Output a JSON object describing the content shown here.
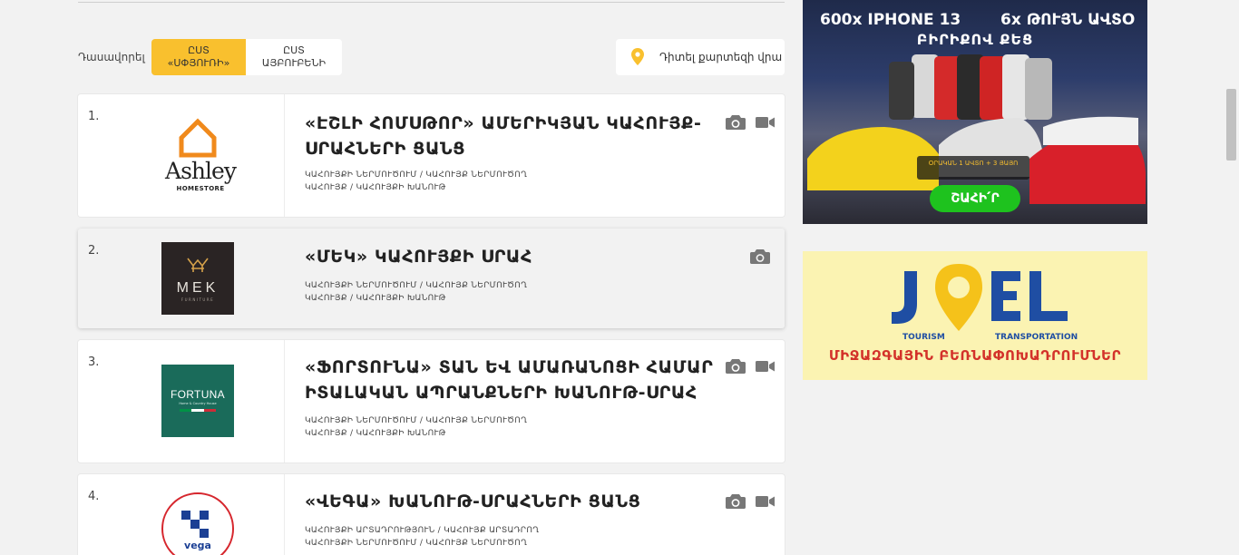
{
  "sort": {
    "label": "Դասավորել",
    "option_active_line1": "ԸՍՏ",
    "option_active_line2": "«ՍՓՅՈՒՌԻ»",
    "option_inactive_line1": "ԸՍՏ",
    "option_inactive_line2": "ԱՅԲՈՒԲԵՆԻ"
  },
  "map_button": {
    "label": "Դիտել քարտեզի վրա",
    "icon": "location-pin-icon",
    "color": "#f9c02e"
  },
  "listings": [
    {
      "number": "1.",
      "title_line1": "«ԷՇԼԻ ՀՈՄՍԹՈՐ» ԱՄԵՐԻԿՅԱՆ ԿԱՀՈՒՅՔ-",
      "title_line2": "ՍՐԱՀՆԵՐԻ ՑԱՆՑ",
      "cat_line1": "ԿԱՀՈՒՅՔԻ ՆԵՐՄՈՒԾՈՒՄ / ԿԱՀՈՒՅՔ ՆԵՐՄՈՒԾՈՂ",
      "cat_line2": "ԿԱՀՈՒՅՔ / ԿԱՀՈՒՅՔԻ ԽԱՆՈՒԹ",
      "logo_word": "Ashley",
      "logo_sub": "HOMESTORE",
      "has_video": true
    },
    {
      "number": "2.",
      "title_line1": "«ՄԵԿ» ԿԱՀՈՒՅՔԻ ՍՐԱՀ",
      "cat_line1": "ԿԱՀՈՒՅՔԻ ՆԵՐՄՈՒԾՈՒՄ / ԿԱՀՈՒՅՔ ՆԵՐՄՈՒԾՈՂ",
      "cat_line2": "ԿԱՀՈՒՅՔ / ԿԱՀՈՒՅՔԻ ԽԱՆՈՒԹ",
      "logo_word": "MEK",
      "logo_sub": "FURNITURE",
      "has_video": false
    },
    {
      "number": "3.",
      "title_line1": "«ՖՈՐՏՈՒՆԱ» ՏԱՆ ԵՎ ԱՄԱՌԱՆՈՑԻ ՀԱՄԱՐ",
      "title_line2": "ԻՏԱԼԱԿԱՆ ԱՊՐԱՆՔՆԵՐԻ ԽԱՆՈՒԹ-ՍՐԱՀ",
      "cat_line1": "ԿԱՀՈՒՅՔԻ ՆԵՐՄՈՒԾՈՒՄ / ԿԱՀՈՒՅՔ ՆԵՐՄՈՒԾՈՂ",
      "cat_line2": "ԿԱՀՈՒՅՔ / ԿԱՀՈՒՅՔԻ ԽԱՆՈՒԹ",
      "logo_word": "FORTUNA",
      "logo_sub": "Home & Country House",
      "has_video": true
    },
    {
      "number": "4.",
      "title_line1": "«ՎԵԳԱ» ԽԱՆՈՒԹ-ՍՐԱՀՆԵՐԻ ՑԱՆՑ",
      "cat_line1": "ԿԱՀՈՒՅՔԻ ԱՐՏԱԴՐՈՒԹՅՈՒՆ / ԿԱՀՈՒՅՔ ԱՐՏԱԴՐՈՂ",
      "cat_line2": "ԿԱՀՈՒՅՔԻ ՆԵՐՄՈՒԾՈՒՄ / ԿԱՀՈՒՅՔ ՆԵՐՄՈՒԾՈՂ",
      "logo_word": "vega",
      "has_video": true
    }
  ],
  "ads": {
    "ad1": {
      "headline_left": "600x IPHONE 13",
      "headline_right": "6x ԹՈՒՅՆ ԱՎՏՕ",
      "headline_line2": "ԲԻՐԻՔՈՎ ՔԵՑ",
      "tag": "ՕՐԱԿԱՆ 1 ԱՎՏՈ + 3 ՅԱՅՈ",
      "cta": "ՇԱՀԻ՛Ր"
    },
    "ad2": {
      "brand": "JOEL",
      "brand_sub_left": "TOURISM",
      "brand_sub_right": "TRANSPORTATION",
      "subtitle": "ՄԻՋԱԶԳԱՅԻՆ ԲԵՌՆԱՓՈԽԱԴՐՈՒՄՆԵՐ"
    }
  }
}
